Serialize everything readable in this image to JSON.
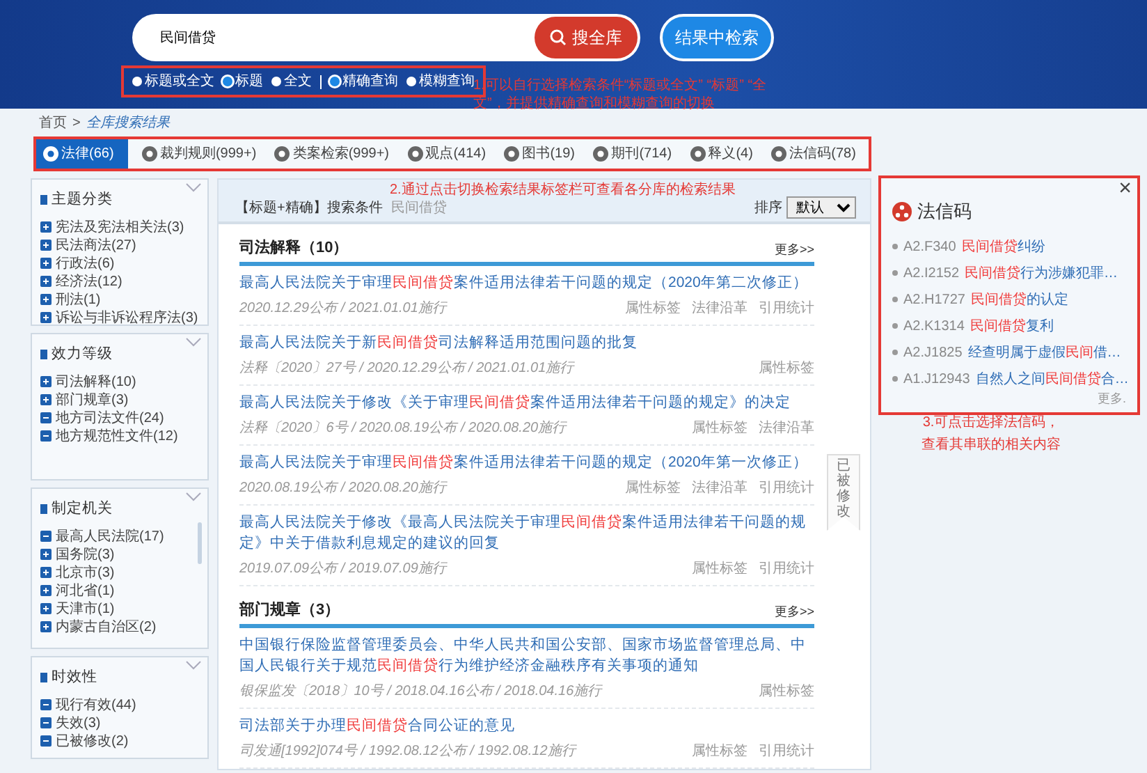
{
  "search": {
    "value": "民间借贷",
    "submit": "搜全库",
    "refine": "结果中检索",
    "scope_options": [
      {
        "label": "标题或全文",
        "selected": false
      },
      {
        "label": "标题",
        "selected": true
      },
      {
        "label": "全文",
        "selected": false
      }
    ],
    "match_options": [
      {
        "label": "精确查询",
        "selected": true
      },
      {
        "label": "模糊查询",
        "selected": false
      }
    ]
  },
  "annotations": [
    {
      "text": "1.可以自行选择检索条件“标题或全文” “标题” “全文”，并提供精确查询和模糊查询的切换"
    },
    {
      "text": "2.通过点击切换检索结果标签栏可查看各分库的检索结果"
    },
    {
      "text": "3.可点击选择法信码，查看其串联的相关内容"
    }
  ],
  "breadcrumb": {
    "items": [
      "首页",
      "全库搜索结果"
    ],
    "separator": ">"
  },
  "tabs": [
    {
      "label": "法律(66)",
      "selected": true
    },
    {
      "label": "裁判规则(999+)",
      "selected": false
    },
    {
      "label": "类案检索(999+)",
      "selected": false
    },
    {
      "label": "观点(414)",
      "selected": false
    },
    {
      "label": "图书(19)",
      "selected": false
    },
    {
      "label": "期刊(714)",
      "selected": false
    },
    {
      "label": "释义(4)",
      "selected": false
    },
    {
      "label": "法信码(78)",
      "selected": false
    }
  ],
  "facets": [
    {
      "title": "主题分类",
      "items": [
        {
          "label": "宪法及宪法相关法(3)",
          "expanded": false
        },
        {
          "label": "民法商法(27)",
          "expanded": false
        },
        {
          "label": "行政法(6)",
          "expanded": false
        },
        {
          "label": "经济法(12)",
          "expanded": false
        },
        {
          "label": "刑法(1)",
          "expanded": false
        },
        {
          "label": "诉讼与非诉讼程序法(3)",
          "expanded": false
        }
      ]
    },
    {
      "title": "效力等级",
      "items": [
        {
          "label": "司法解释(10)",
          "expanded": false
        },
        {
          "label": "部门规章(3)",
          "expanded": false
        },
        {
          "label": "地方司法文件(24)",
          "expanded": true
        },
        {
          "label": "地方规范性文件(12)",
          "expanded": true
        }
      ]
    },
    {
      "title": "制定机关",
      "items": [
        {
          "label": "最高人民法院(17)",
          "expanded": true
        },
        {
          "label": "国务院(3)",
          "expanded": false
        },
        {
          "label": "北京市(3)",
          "expanded": false
        },
        {
          "label": "河北省(1)",
          "expanded": false
        },
        {
          "label": "天津市(1)",
          "expanded": false
        },
        {
          "label": "内蒙古自治区(2)",
          "expanded": false
        }
      ]
    },
    {
      "title": "时效性",
      "items": [
        {
          "label": "现行有效(44)",
          "expanded": true
        },
        {
          "label": "失效(3)",
          "expanded": true
        },
        {
          "label": "已被修改(2)",
          "expanded": true
        }
      ]
    }
  ],
  "criteria": {
    "label": "【标题+精确】搜索条件",
    "value": "民间借贷"
  },
  "sort": {
    "label": "排序",
    "value": "默认"
  },
  "sections": [
    {
      "title": "司法解释（10）",
      "more": "更多>>",
      "items": [
        {
          "title": [
            {
              "text": "最高人民法院关于审理",
              "highlighted": false
            },
            {
              "text": "民间借贷",
              "highlighted": true
            },
            {
              "text": "案件适用法律若干问题的规定（2020年第二次修正）",
              "highlighted": false
            }
          ],
          "meta": "2020.12.29公布 / 2021.01.01施行",
          "links": [
            "属性标签",
            "法律沿革",
            "引用统计"
          ]
        },
        {
          "title": [
            {
              "text": "最高人民法院关于新",
              "highlighted": false
            },
            {
              "text": "民间借贷",
              "highlighted": true
            },
            {
              "text": "司法解释适用范围问题的批复",
              "highlighted": false
            }
          ],
          "meta": "法释〔2020〕27号 / 2020.12.29公布 / 2021.01.01施行",
          "links": [
            "属性标签"
          ]
        },
        {
          "title": [
            {
              "text": "最高人民法院关于修改《关于审理",
              "highlighted": false
            },
            {
              "text": "民间借贷",
              "highlighted": true
            },
            {
              "text": "案件适用法律若干问题的规定》的决定",
              "highlighted": false
            }
          ],
          "meta": "法释〔2020〕6号 / 2020.08.19公布 / 2020.08.20施行",
          "links": [
            "属性标签",
            "法律沿革"
          ]
        },
        {
          "title": [
            {
              "text": "最高人民法院关于审理",
              "highlighted": false
            },
            {
              "text": "民间借贷",
              "highlighted": true
            },
            {
              "text": "案件适用法律若干问题的规定（2020年第一次修正）",
              "highlighted": false
            }
          ],
          "meta": "2020.08.19公布 / 2020.08.20施行",
          "links": [
            "属性标签",
            "法律沿革",
            "引用统计"
          ],
          "badge": "已被修改"
        },
        {
          "title": [
            {
              "text": "最高人民法院关于修改《最高人民法院关于审理",
              "highlighted": false
            },
            {
              "text": "民间借贷",
              "highlighted": true
            },
            {
              "text": "案件适用法律若干问题的规定》中关于借款利息规定的建议的回复",
              "highlighted": false
            }
          ],
          "meta": "2019.07.09公布 / 2019.07.09施行",
          "links": [
            "属性标签",
            "引用统计"
          ]
        }
      ]
    },
    {
      "title": "部门规章（3）",
      "more": "更多>>",
      "items": [
        {
          "title": [
            {
              "text": "中国银行保险监督管理委员会、中华人民共和国公安部、国家市场监督管理总局、中国人民银行关于规范",
              "highlighted": false
            },
            {
              "text": "民间借贷",
              "highlighted": true
            },
            {
              "text": "行为维护经济金融秩序有关事项的通知",
              "highlighted": false
            }
          ],
          "meta": "银保监发〔2018〕10号 / 2018.04.16公布 / 2018.04.16施行",
          "links": [
            "属性标签"
          ]
        },
        {
          "title": [
            {
              "text": "司法部关于办理",
              "highlighted": false
            },
            {
              "text": "民间借贷",
              "highlighted": true
            },
            {
              "text": "合同公证的意见",
              "highlighted": false
            }
          ],
          "meta": "司发通[1992]074号 / 1992.08.12公布 / 1992.08.12施行",
          "links": [
            "属性标签",
            "引用统计"
          ]
        }
      ]
    }
  ],
  "codes_panel": {
    "title": "法信码",
    "close": "×",
    "more": "更多.",
    "items": [
      {
        "code": "A2.F340",
        "text": [
          {
            "text": "民间借贷",
            "highlighted": true
          },
          {
            "text": "纠纷",
            "highlighted": false
          }
        ]
      },
      {
        "code": "A2.I2152",
        "text": [
          {
            "text": "民间借贷",
            "highlighted": true
          },
          {
            "text": "行为涉嫌犯罪…",
            "highlighted": false
          }
        ]
      },
      {
        "code": "A2.H1727",
        "text": [
          {
            "text": "民间借贷",
            "highlighted": true
          },
          {
            "text": "的认定",
            "highlighted": false
          }
        ]
      },
      {
        "code": "A2.K1314",
        "text": [
          {
            "text": "民间借贷",
            "highlighted": true
          },
          {
            "text": "复利",
            "highlighted": false
          }
        ]
      },
      {
        "code": "A2.J1825",
        "text": [
          {
            "text": "经查明属于虚假",
            "highlighted": false
          },
          {
            "text": "民间",
            "highlighted": true
          },
          {
            "text": "借…",
            "highlighted": false
          }
        ]
      },
      {
        "code": "A1.J12943",
        "text": [
          {
            "text": "自然人之间",
            "highlighted": false
          },
          {
            "text": "民间借贷",
            "highlighted": true
          },
          {
            "text": "合…",
            "highlighted": false
          }
        ]
      }
    ]
  }
}
